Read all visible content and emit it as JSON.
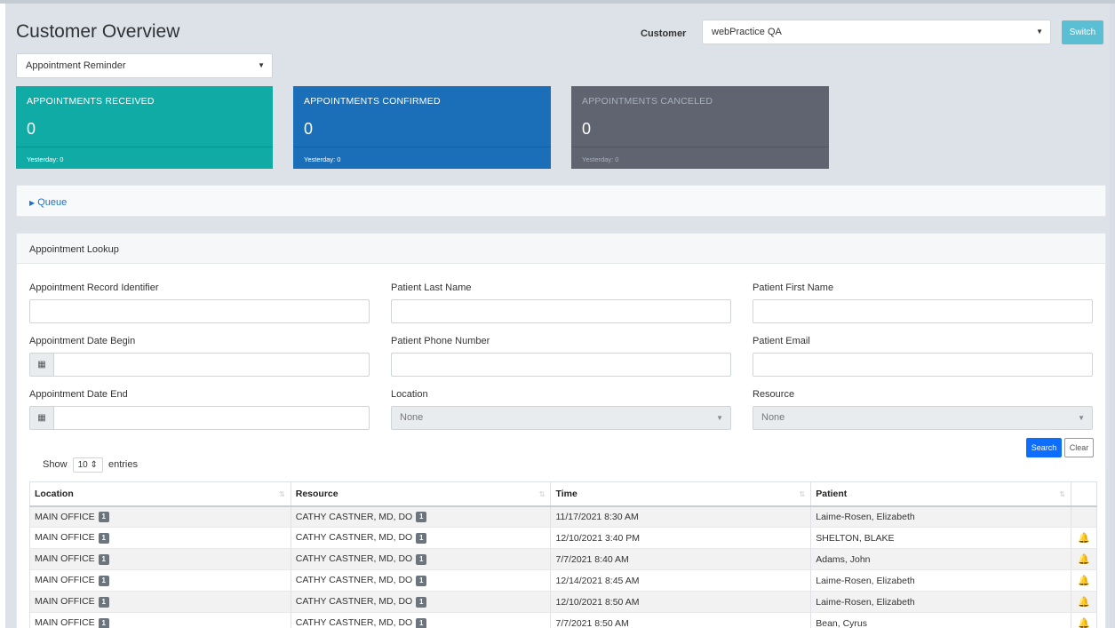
{
  "header": {
    "title": "Customer Overview",
    "customer_label": "Customer",
    "customer_value": "webPractice QA",
    "switch_label": "Switch"
  },
  "mode_select": {
    "value": "Appointment Reminder"
  },
  "tiles": [
    {
      "label": "APPOINTMENTS RECEIVED",
      "value": "0",
      "footer": "Yesterday: 0",
      "color": "#11aba6"
    },
    {
      "label": "APPOINTMENTS CONFIRMED",
      "value": "0",
      "footer": "Yesterday: 0",
      "color": "#1b6fb9"
    },
    {
      "label": "APPOINTMENTS CANCELED",
      "value": "0",
      "footer": "Yesterday: 0",
      "color": "#5f6470"
    }
  ],
  "queue": {
    "label": "Queue"
  },
  "lookup": {
    "title": "Appointment Lookup",
    "fields": {
      "record_id": "Appointment Record Identifier",
      "last_name": "Patient Last Name",
      "first_name": "Patient First Name",
      "date_begin": "Appointment Date Begin",
      "phone": "Patient Phone Number",
      "email": "Patient Email",
      "date_end": "Appointment Date End",
      "location": "Location",
      "resource": "Resource"
    },
    "location_value": "None",
    "resource_value": "None",
    "search_label": "Search",
    "clear_label": "Clear",
    "show_label": "Show",
    "entries_value": "10",
    "entries_label": "entries"
  },
  "table": {
    "columns": [
      "Location",
      "Resource",
      "Time",
      "Patient"
    ],
    "rows": [
      {
        "location": "MAIN OFFICE",
        "location_badge": "1",
        "resource": "CATHY CASTNER, MD, DO",
        "resource_badge": "1",
        "time": "11/17/2021 8:30 AM",
        "patient": "Laime-Rosen, Elizabeth",
        "bell": ""
      },
      {
        "location": "MAIN OFFICE",
        "location_badge": "1",
        "resource": "CATHY CASTNER, MD, DO",
        "resource_badge": "1",
        "time": "12/10/2021 3:40 PM",
        "patient": "SHELTON, BLAKE",
        "bell": "🔔"
      },
      {
        "location": "MAIN OFFICE",
        "location_badge": "1",
        "resource": "CATHY CASTNER, MD, DO",
        "resource_badge": "1",
        "time": "7/7/2021 8:40 AM",
        "patient": "Adams, John",
        "bell": "🔔"
      },
      {
        "location": "MAIN OFFICE",
        "location_badge": "1",
        "resource": "CATHY CASTNER, MD, DO",
        "resource_badge": "1",
        "time": "12/14/2021 8:45 AM",
        "patient": "Laime-Rosen, Elizabeth",
        "bell": "🔔"
      },
      {
        "location": "MAIN OFFICE",
        "location_badge": "1",
        "resource": "CATHY CASTNER, MD, DO",
        "resource_badge": "1",
        "time": "12/10/2021 8:50 AM",
        "patient": "Laime-Rosen, Elizabeth",
        "bell": "🔔"
      },
      {
        "location": "MAIN OFFICE",
        "location_badge": "1",
        "resource": "CATHY CASTNER, MD, DO",
        "resource_badge": "1",
        "time": "7/7/2021 8:50 AM",
        "patient": "Bean, Cyrus",
        "bell": "🔔"
      }
    ]
  }
}
